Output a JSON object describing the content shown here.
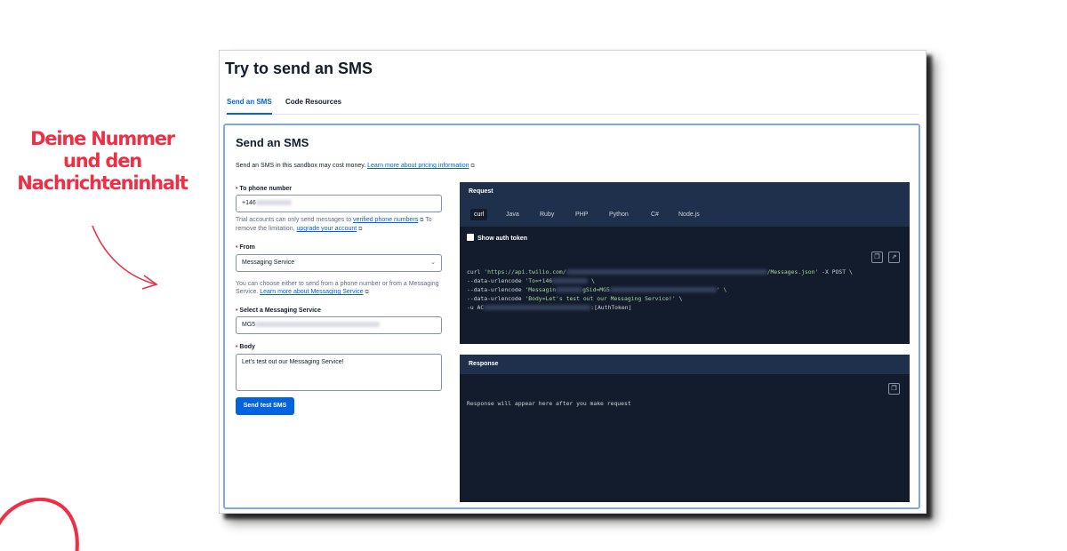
{
  "annotation": {
    "line1": "Deine Nummer",
    "line2": "und den",
    "line3": "Nachrichteninhalt"
  },
  "page": {
    "title": "Try to send an SMS",
    "tabs": [
      {
        "label": "Send an SMS",
        "active": true
      },
      {
        "label": "Code Resources",
        "active": false
      }
    ]
  },
  "form": {
    "title": "Send an SMS",
    "cost_note": "Send an SMS in this sandbox may cost money.",
    "cost_link": "Learn more about pricing information",
    "to_label": "To phone number",
    "to_value": "+146",
    "trial_note_prefix": "Trial accounts can only send messages to",
    "trial_link": "verified phone numbers",
    "trial_note_mid": "To remove the limitation,",
    "upgrade_link": "upgrade your account",
    "from_label": "From",
    "from_value": "Messaging Service",
    "from_help": "You can choose either to send from a phone number or from a Messaging Service.",
    "from_help_link": "Learn more about Messaging Service",
    "service_label": "Select a Messaging Service",
    "service_value": "MG5",
    "body_label": "Body",
    "body_value": "Let's test out our Messaging Service!",
    "send_button": "Send test SMS",
    "required_mark": "•"
  },
  "request": {
    "title": "Request",
    "languages": [
      "curl",
      "Java",
      "Ruby",
      "PHP",
      "Python",
      "C#",
      "Node.js"
    ],
    "active_language": "curl",
    "auth_toggle": "Show auth token",
    "code_line1_a": "curl ",
    "code_line1_b": "'https://api.twilio.com/",
    "code_line1_c": "/Messages.json'",
    "code_line1_d": " -X POST \\",
    "code_line2_a": "--data-urlencode ",
    "code_line2_b": "'To=+146",
    "code_line2_c": " \\",
    "code_line3_a": "--data-urlencode ",
    "code_line3_b": "'Messagin",
    "code_line3_c": "gSid=MG5",
    "code_line3_d": "' \\",
    "code_line4_a": "--data-urlencode ",
    "code_line4_b": "'Body=Let's test out our Messaging Service!'",
    "code_line4_c": " \\",
    "code_line5_a": "-u AC",
    "code_line5_b": ":[AuthToken]"
  },
  "response": {
    "title": "Response",
    "placeholder": "Response will appear here after you make request"
  },
  "colors": {
    "accent": "#0263e0",
    "annotation": "#ef2f45",
    "code_bg": "#121c2d"
  }
}
